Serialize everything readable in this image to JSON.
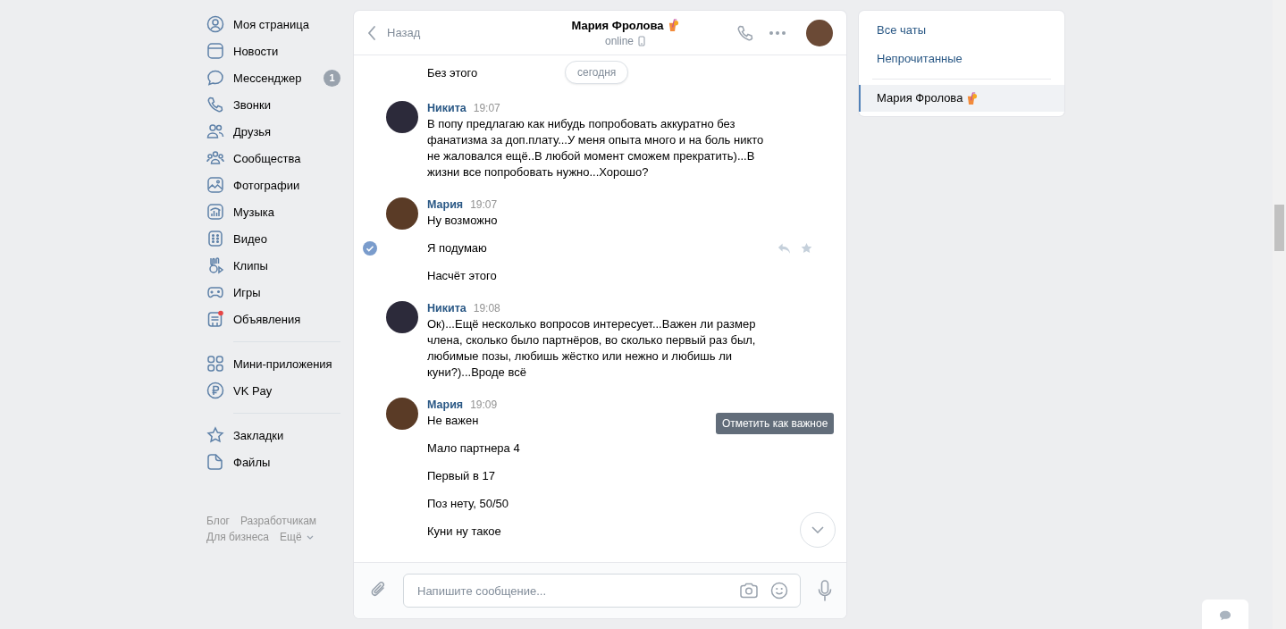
{
  "nav": {
    "groups": [
      [
        {
          "label": "Моя страница"
        },
        {
          "label": "Новости"
        },
        {
          "label": "Мессенджер",
          "badge": "1"
        },
        {
          "label": "Звонки"
        },
        {
          "label": "Друзья"
        },
        {
          "label": "Сообщества"
        },
        {
          "label": "Фотографии"
        },
        {
          "label": "Музыка"
        },
        {
          "label": "Видео"
        },
        {
          "label": "Клипы"
        },
        {
          "label": "Игры"
        },
        {
          "label": "Объявления"
        }
      ],
      [
        {
          "label": "Мини-приложения"
        },
        {
          "label": "VK Pay"
        }
      ],
      [
        {
          "label": "Закладки"
        },
        {
          "label": "Файлы"
        }
      ]
    ],
    "footer_links": [
      "Блог",
      "Разработчикам",
      "Для бизнеса",
      "Ещё"
    ]
  },
  "chat": {
    "back": "Назад",
    "title": "Мария Фролова",
    "status": "online",
    "date_chip": "сегодня",
    "tooltip": "Отметить как важное",
    "top_line": {
      "text": "Без этого"
    },
    "groups": [
      {
        "author": "Никита",
        "time": "19:07",
        "lines": [
          {
            "text": "В попу предлагаю как нибудь попробовать аккуратно без фанатизма за доп.плату...У меня опыта много и на боль никто не жаловался ещё..В любой момент сможем прекратить)...В жизни все попробовать нужно...Хорошо?",
            "selected": false
          }
        ]
      },
      {
        "author": "Мария",
        "time": "19:07",
        "lines": [
          {
            "text": "Ну возможно",
            "selected": false
          },
          {
            "text": "Я подумаю",
            "selected": true
          },
          {
            "text": "Насчёт этого",
            "selected": false
          }
        ]
      },
      {
        "author": "Никита",
        "time": "19:08",
        "lines": [
          {
            "text": "Ок)...Ещё несколько вопросов интересует...Важен ли размер члена, сколько было партнёров, во сколько первый раз был, любимые позы, любишь жёстко или нежно и любишь ли куни?)...Вроде всё",
            "selected": false
          }
        ]
      },
      {
        "author": "Мария",
        "time": "19:09",
        "lines": [
          {
            "text": "Не важен",
            "selected": false
          },
          {
            "text": "Мало партнера 4",
            "selected": false
          },
          {
            "text": "Первый в 17",
            "selected": false
          },
          {
            "text": "Поз нету, 50/50",
            "selected": false
          },
          {
            "text": "Куни ну такое",
            "selected": false
          }
        ]
      }
    ],
    "composer": {
      "placeholder": "Напишите сообщение..."
    }
  },
  "filters": {
    "items": [
      {
        "label": "Все чаты",
        "selected": false
      },
      {
        "label": "Непрочитанные",
        "selected": false
      }
    ],
    "chats": [
      {
        "name": "Мария Фролова",
        "selected": true
      }
    ]
  }
}
